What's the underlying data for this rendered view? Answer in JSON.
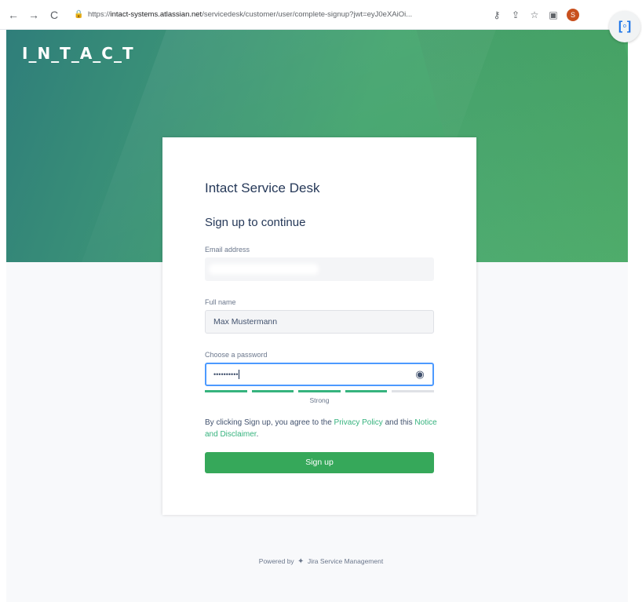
{
  "browser": {
    "url_prefix": "https://",
    "url_host": "intact-systems.atlassian.net",
    "url_path": "/servicedesk/customer/user/complete-signup?jwt=eyJ0eXAiOi...",
    "profile_initial": "S"
  },
  "brand": {
    "logo_text": "I_N_T_A_C_T",
    "hero_colors": [
      "#2f7e7a",
      "#4aab67"
    ]
  },
  "card": {
    "title": "Intact Service Desk",
    "subtitle": "Sign up to continue",
    "email_label": "Email address",
    "email_value": "",
    "fullname_label": "Full name",
    "fullname_value": "Max Mustermann",
    "password_label": "Choose a password",
    "password_dots": "••••••••••",
    "password_strength_segments": 4,
    "password_strength_filled": 4,
    "password_strength_label": "Strong",
    "terms_prefix": "By clicking Sign up, you agree to the ",
    "privacy_link": "Privacy Policy",
    "terms_mid": " and this ",
    "notice_link": "Notice and Disclaimer",
    "terms_suffix": ".",
    "signup_label": "Sign up",
    "accent_color": "#36a85a"
  },
  "footer": {
    "powered_prefix": "Powered by",
    "product": "Jira Service Management"
  }
}
